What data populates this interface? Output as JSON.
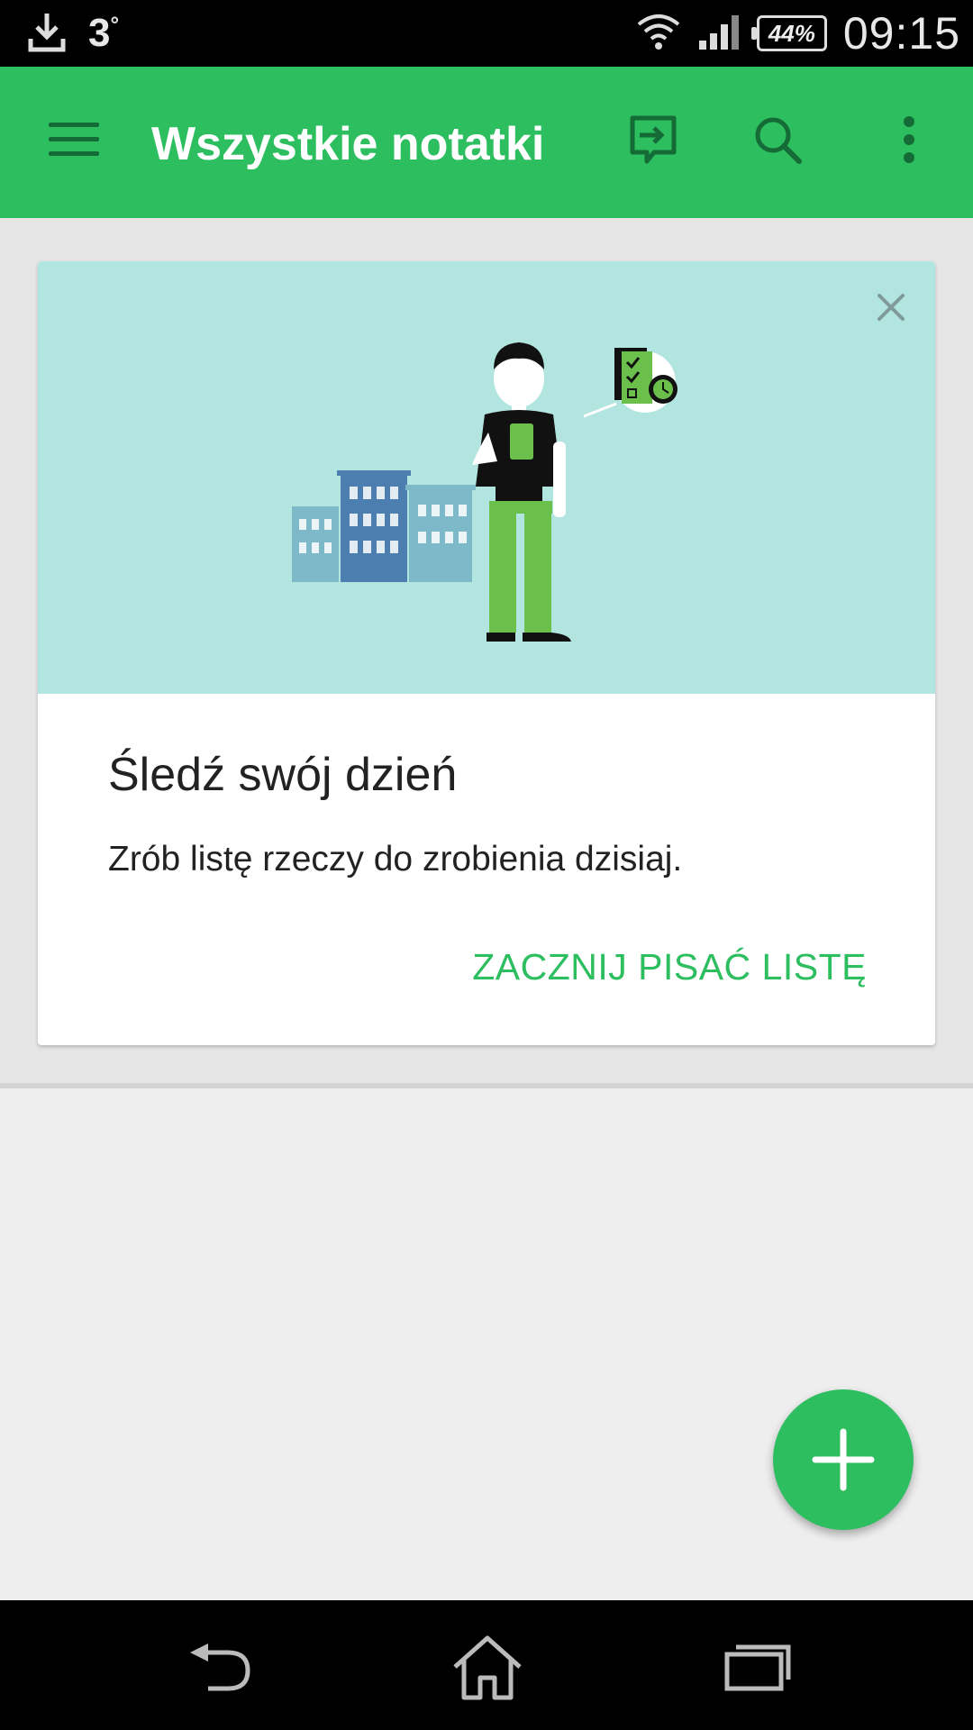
{
  "status_bar": {
    "temperature": "3",
    "temperature_unit": "°",
    "battery": "44%",
    "time": "09:15",
    "icons": [
      "download-icon",
      "wifi-icon",
      "signal-icon",
      "battery-icon"
    ]
  },
  "app_bar": {
    "title": "Wszystkie notatki",
    "icons": [
      "menu-icon",
      "sync-icon",
      "search-icon",
      "more-vert-icon"
    ],
    "background_color": "#2dbe60"
  },
  "card": {
    "title": "Śledź swój dzień",
    "description": "Zrób listę rzeczy do zrobienia dzisiaj.",
    "action_label": "ZACZNIJ PISAĆ LISTĘ",
    "hero_color": "#b2e5e0",
    "accent_color": "#2dbe60"
  },
  "fab": {
    "icon": "plus-icon"
  },
  "nav_bar": {
    "icons": [
      "back-icon",
      "home-icon",
      "recents-icon"
    ]
  }
}
